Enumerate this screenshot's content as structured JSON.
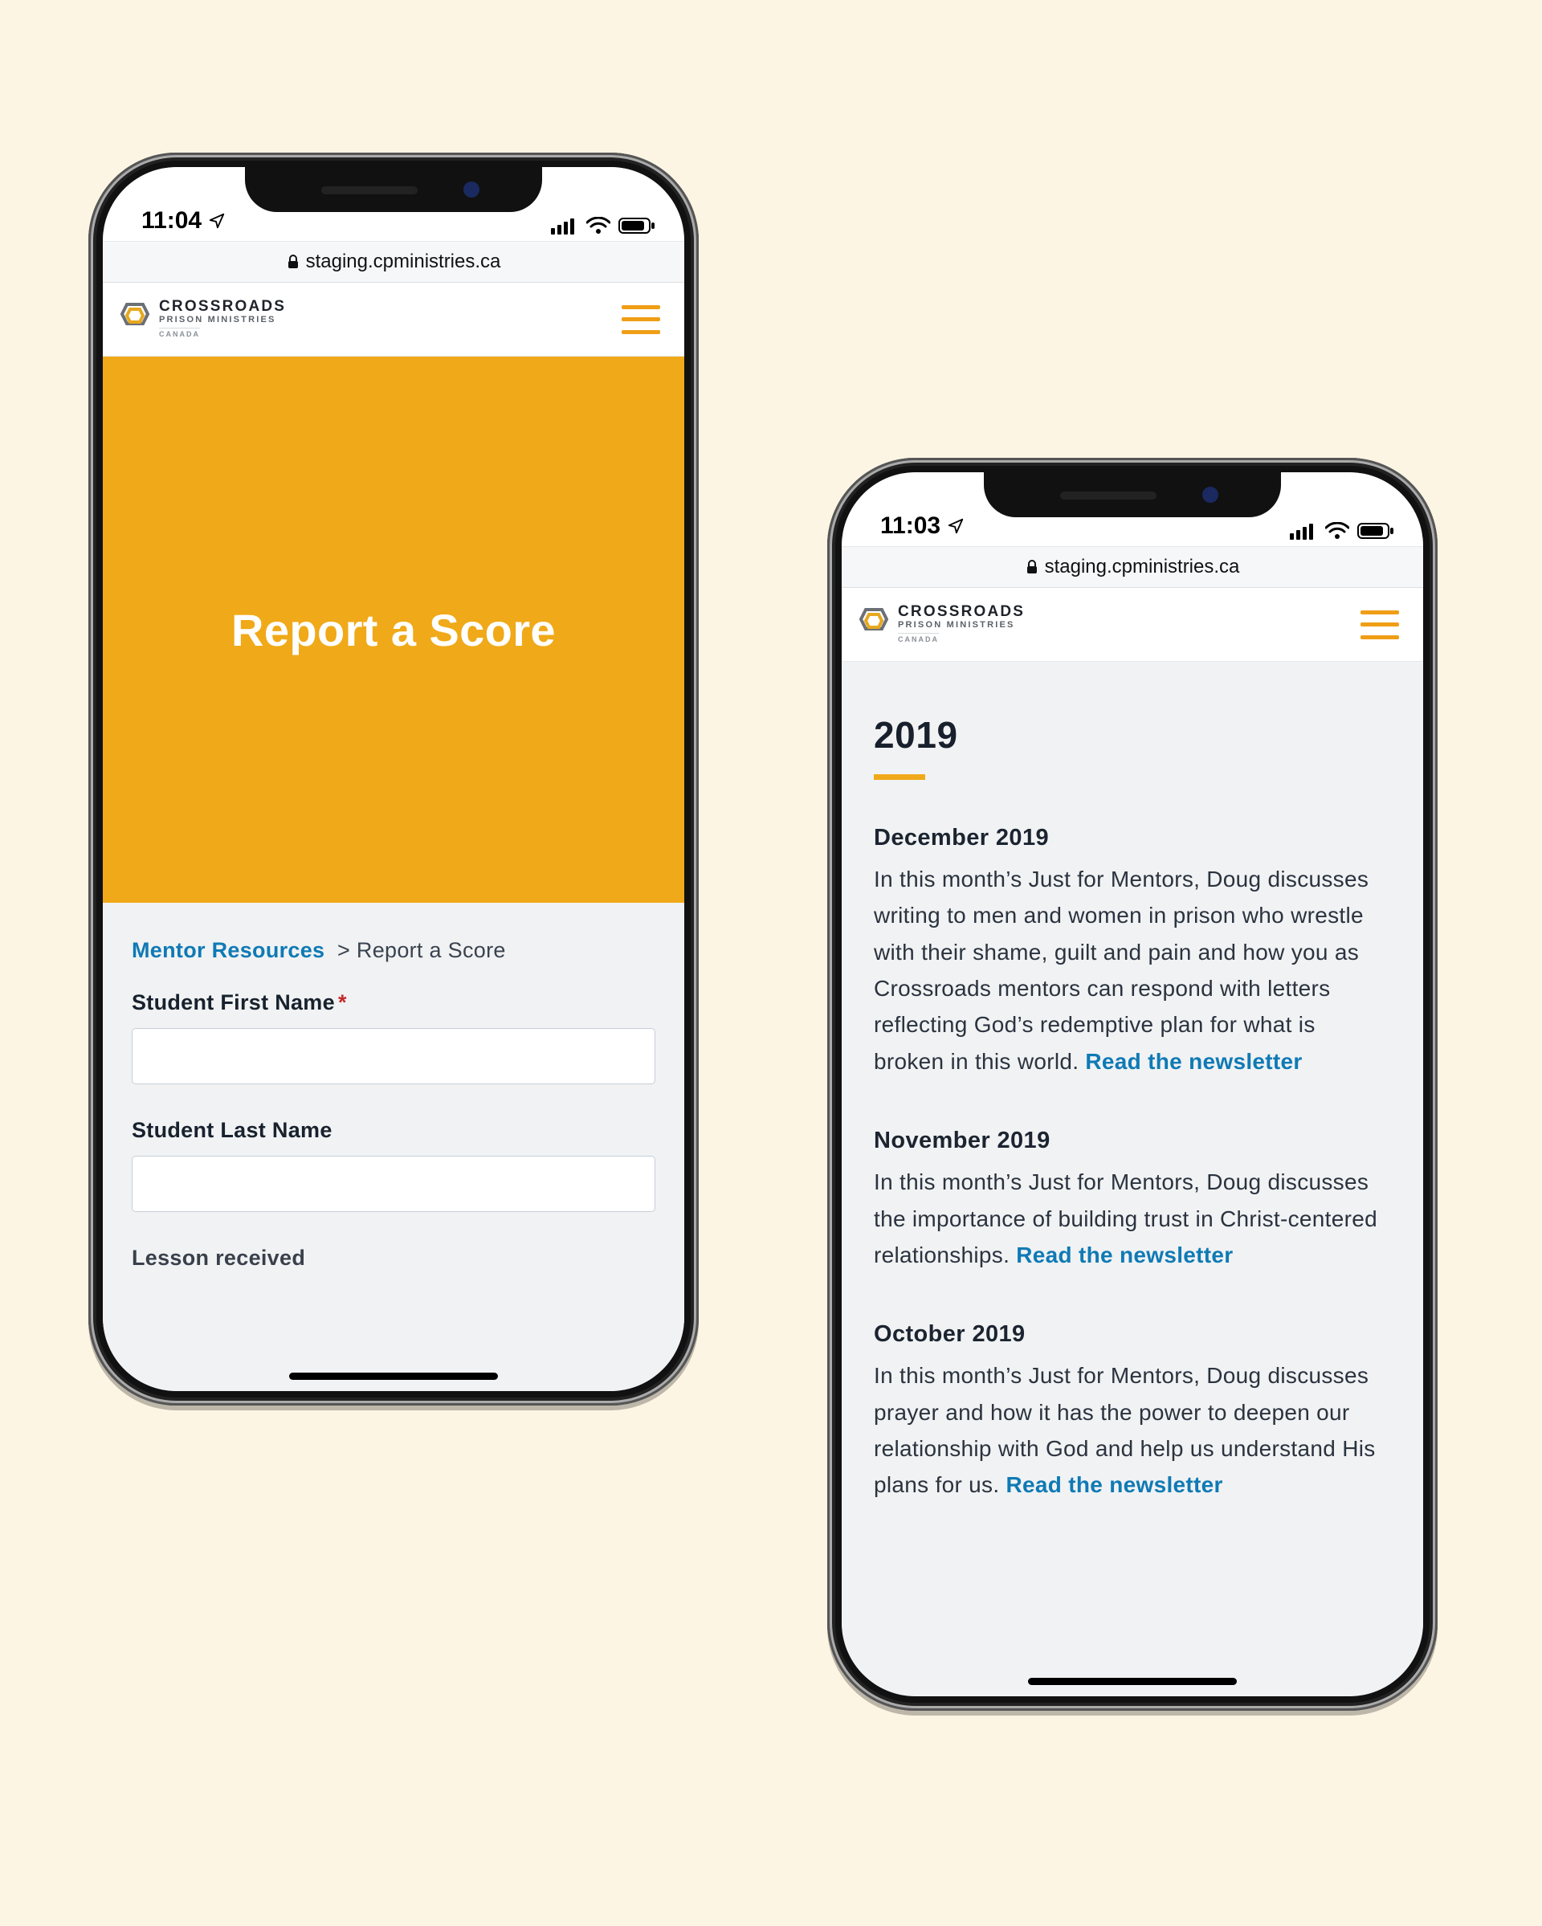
{
  "left": {
    "status": {
      "time": "11:04"
    },
    "url": "staging.cpministries.ca",
    "brand": {
      "line1": "CROSSROADS",
      "line2": "PRISON MINISTRIES",
      "line3": "CANADA"
    },
    "hero_title": "Report a Score",
    "breadcrumb": {
      "root": "Mentor Resources",
      "sep": ">",
      "current": "Report a Score"
    },
    "fields": {
      "first_name": {
        "label": "Student First Name",
        "required": "*",
        "value": ""
      },
      "last_name": {
        "label": "Student Last Name",
        "value": ""
      },
      "lesson": {
        "label": "Lesson received"
      }
    }
  },
  "right": {
    "status": {
      "time": "11:03"
    },
    "url": "staging.cpministries.ca",
    "brand": {
      "line1": "CROSSROADS",
      "line2": "PRISON MINISTRIES",
      "line3": "CANADA"
    },
    "year": "2019",
    "entries": [
      {
        "title": "December 2019",
        "body": "In this month’s Just for Mentors, Doug discusses writing to men and women in prison who wrestle with their shame, guilt and pain and how you as Crossroads mentors can respond with letters reflecting God’s redemptive plan for what is broken in this world. ",
        "link": "Read the newsletter"
      },
      {
        "title": "November 2019",
        "body": "In this month’s Just for Mentors, Doug discusses the importance of building trust in Christ-centered relationships. ",
        "link": "Read the newsletter"
      },
      {
        "title": "October 2019",
        "body": "In this month’s Just for Mentors, Doug discusses prayer and how it has the power to deepen our relationship with God and help us understand His plans for us. ",
        "link": "Read the newsletter"
      }
    ]
  }
}
